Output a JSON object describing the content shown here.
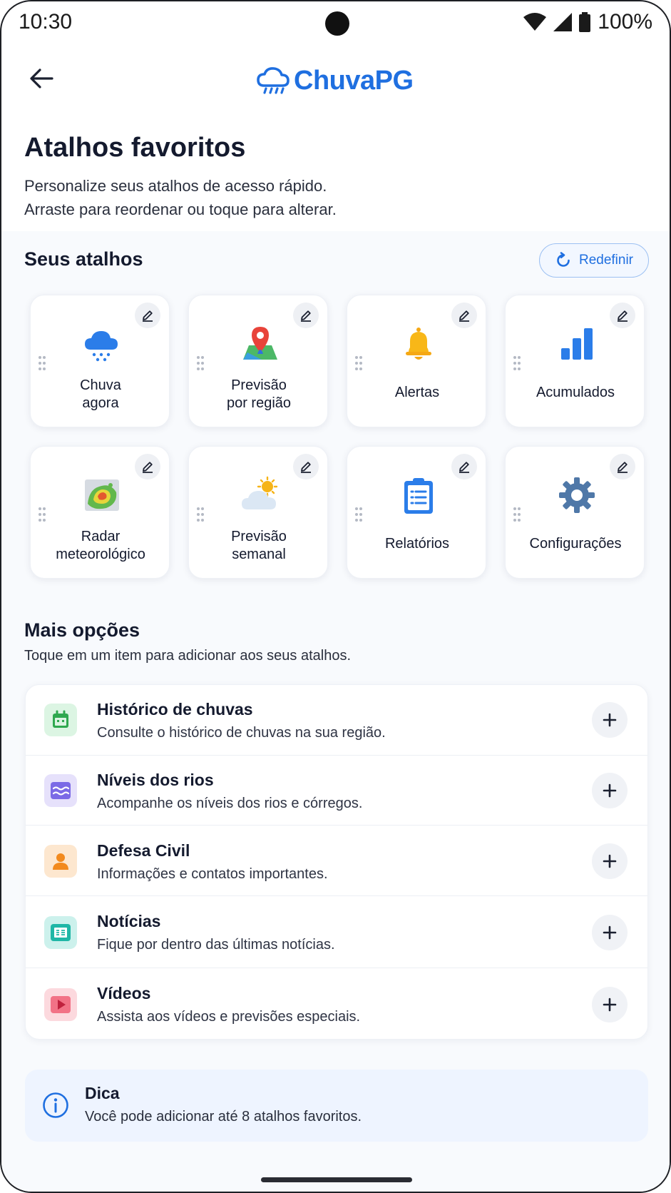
{
  "status_bar": {
    "time": "10:30",
    "battery": "100%"
  },
  "header": {
    "brand": "ChuvaPG",
    "back_icon": "arrow-left-icon"
  },
  "page": {
    "title": "Atalhos favoritos",
    "subtitle_line1": "Personalize seus atalhos de acesso rápido.",
    "subtitle_line2": "Arraste para reordenar ou toque para alterar."
  },
  "shortcuts": {
    "title": "Seus atalhos",
    "reset_label": "Redefinir",
    "items": [
      {
        "line1": "Chuva",
        "line2": "agora",
        "icon": "rain-cloud-icon"
      },
      {
        "line1": "Previsão",
        "line2": "por região",
        "icon": "map-pin-icon"
      },
      {
        "line1": "Alertas",
        "line2": "",
        "icon": "bell-icon"
      },
      {
        "line1": "Acumulados",
        "line2": "",
        "icon": "bar-chart-icon"
      },
      {
        "line1": "Radar",
        "line2": "meteorológico",
        "icon": "radar-map-icon"
      },
      {
        "line1": "Previsão",
        "line2": "semanal",
        "icon": "sun-cloud-icon"
      },
      {
        "line1": "Relatórios",
        "line2": "",
        "icon": "clipboard-icon"
      },
      {
        "line1": "Configurações",
        "line2": "",
        "icon": "gear-icon"
      }
    ]
  },
  "more": {
    "title": "Mais opções",
    "subtitle": "Toque em um item para adicionar aos seus atalhos.",
    "items": [
      {
        "title": "Histórico de chuvas",
        "desc": "Consulte o histórico de chuvas na sua região.",
        "icon": "calendar-icon",
        "color": "#2fa84f",
        "bg": "#dcf5e3"
      },
      {
        "title": "Níveis dos rios",
        "desc": "Acompanhe os níveis dos rios e córregos.",
        "icon": "waves-icon",
        "color": "#7b6ae6",
        "bg": "#e6e1fb"
      },
      {
        "title": "Defesa Civil",
        "desc": "Informações e contatos importantes.",
        "icon": "person-icon",
        "color": "#f28a1e",
        "bg": "#fde7cf"
      },
      {
        "title": "Notícias",
        "desc": "Fique por dentro das últimas notícias.",
        "icon": "newspaper-icon",
        "color": "#1fb7a6",
        "bg": "#ccf1ec"
      },
      {
        "title": "Vídeos",
        "desc": "Assista aos vídeos e previsões especiais.",
        "icon": "play-icon",
        "color": "#e0455e",
        "bg": "#fcd9de"
      }
    ]
  },
  "tip": {
    "title": "Dica",
    "text": "Você pode adicionar até 8 atalhos favoritos."
  },
  "colors": {
    "accent": "#1f6fe0",
    "text": "#141a2e"
  }
}
